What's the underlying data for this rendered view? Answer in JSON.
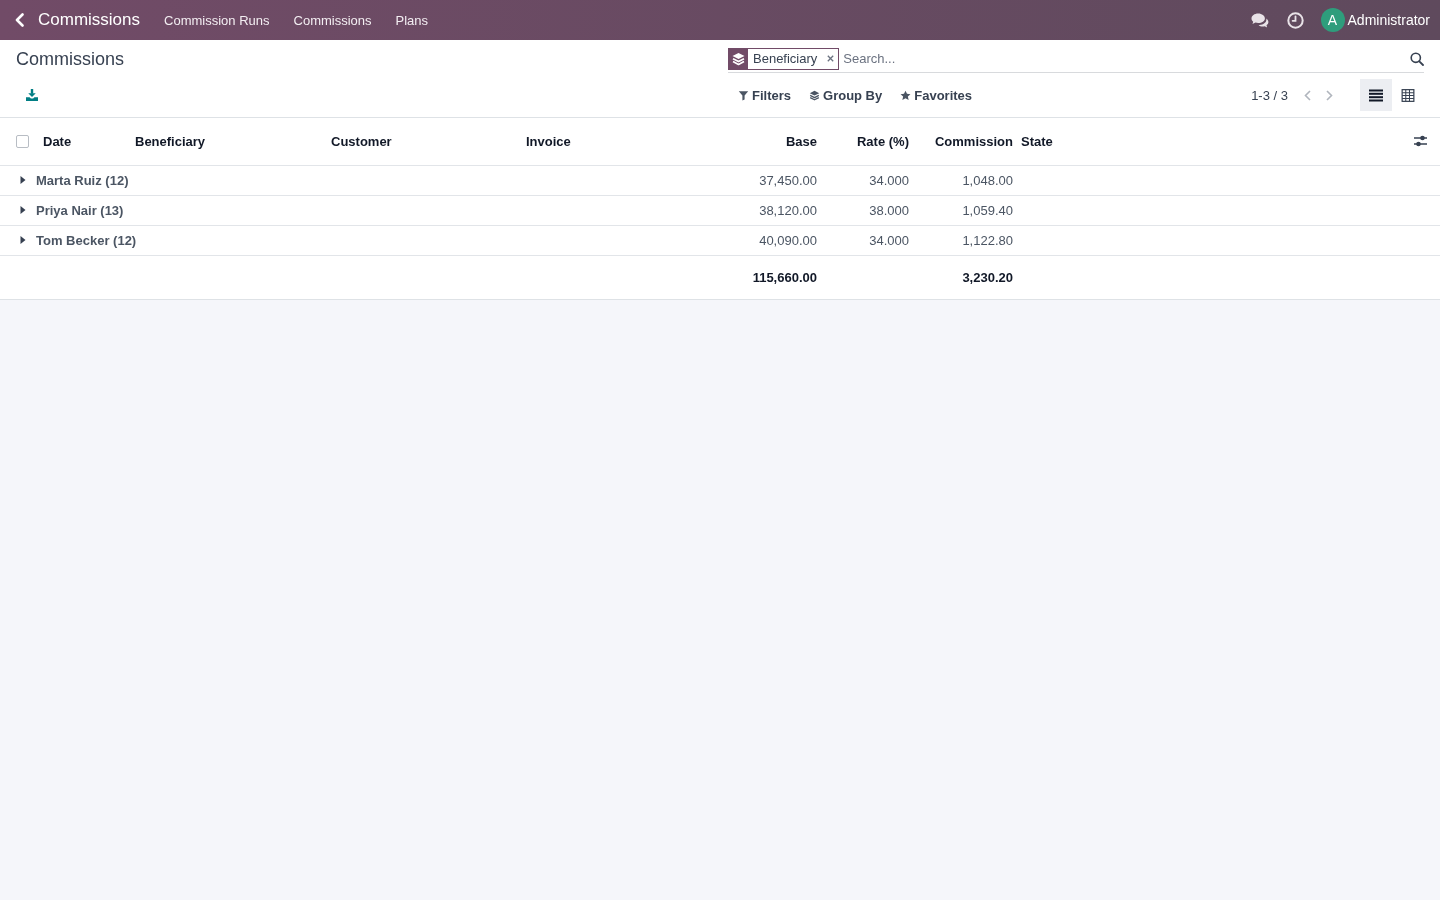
{
  "navbar": {
    "app_title": "Commissions",
    "menu": [
      "Commission Runs",
      "Commissions",
      "Plans"
    ],
    "user": {
      "initial": "A",
      "name": "Administrator"
    }
  },
  "control_panel": {
    "title": "Commissions",
    "search": {
      "facets": [
        {
          "kind": "group_by",
          "label": "Beneficiary"
        }
      ],
      "placeholder": "Search..."
    },
    "menus": [
      {
        "kind": "filter",
        "label": "Filters"
      },
      {
        "kind": "group_by",
        "label": "Group By"
      },
      {
        "kind": "favorite",
        "label": "Favorites"
      }
    ],
    "pager": "1-3 / 3",
    "views": [
      {
        "kind": "list",
        "selected": true
      },
      {
        "kind": "pivot",
        "selected": false
      }
    ]
  },
  "table": {
    "select_all": {
      "checked": false
    },
    "columns": [
      {
        "label": "Date",
        "kind": "text"
      },
      {
        "label": "Beneficiary",
        "kind": "text"
      },
      {
        "label": "Customer",
        "kind": "text"
      },
      {
        "label": "Invoice",
        "kind": "text"
      },
      {
        "label": "Base",
        "kind": "number",
        "total": "115,660.00"
      },
      {
        "label": "Rate (%)",
        "kind": "number"
      },
      {
        "label": "Commission",
        "kind": "number",
        "total": "3,230.20"
      },
      {
        "label": "State",
        "kind": "text"
      }
    ],
    "groups": [
      {
        "name": "Marta Ruiz (12)",
        "expanded": false,
        "aggregates": [
          "37,450.00",
          "34.000",
          "1,048.00"
        ]
      },
      {
        "name": "Priya Nair (13)",
        "expanded": false,
        "aggregates": [
          "38,120.00",
          "38.000",
          "1,059.40"
        ]
      },
      {
        "name": "Tom Becker (12)",
        "expanded": false,
        "aggregates": [
          "40,090.00",
          "34.000",
          "1,122.80"
        ]
      }
    ]
  }
}
